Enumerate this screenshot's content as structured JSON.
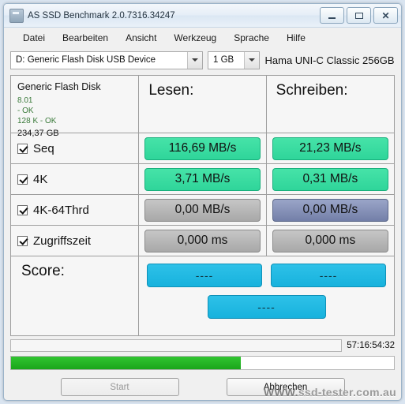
{
  "window": {
    "title": "AS SSD Benchmark 2.0.7316.34247",
    "icon": "app-icon",
    "buttons": {
      "minimize": "minimize-icon",
      "maximize": "maximize-icon",
      "close": "close-icon"
    }
  },
  "menu": [
    "Datei",
    "Bearbeiten",
    "Ansicht",
    "Werkzeug",
    "Sprache",
    "Hilfe"
  ],
  "selector": {
    "device": "D: Generic Flash Disk USB Device",
    "size": "1 GB",
    "product": "Hama UNI-C Classic 256GB"
  },
  "info": {
    "title": "Generic Flash Disk",
    "line1": "8.01",
    "line2": "- OK",
    "line3": "128 K - OK",
    "capacity": "234,37 GB"
  },
  "headers": {
    "read": "Lesen:",
    "write": "Schreiben:"
  },
  "tests": [
    {
      "label": "Seq",
      "checked": true,
      "read": "116,69 MB/s",
      "write": "21,23 MB/s",
      "read_style": "vb-green",
      "write_style": "vb-green"
    },
    {
      "label": "4K",
      "checked": true,
      "read": "3,71 MB/s",
      "write": "0,31 MB/s",
      "read_style": "vb-green",
      "write_style": "vb-green"
    },
    {
      "label": "4K-64Thrd",
      "checked": true,
      "read": "0,00 MB/s",
      "write": "0,00 MB/s",
      "read_style": "vb-gray",
      "write_style": "vb-blueg"
    },
    {
      "label": "Zugriffszeit",
      "checked": true,
      "read": "0,000 ms",
      "write": "0,000 ms",
      "read_style": "vb-gray",
      "write_style": "vb-gray"
    }
  ],
  "score": {
    "label": "Score:",
    "read": "----",
    "write": "----",
    "total": "----"
  },
  "status": {
    "text": "",
    "timer": "57:16:54:32",
    "progress_percent": 60
  },
  "buttons": {
    "start": "Start",
    "cancel": "Abbrechen"
  },
  "watermark": {
    "main": "WWW.",
    "rest": "ssd-tester.com.au"
  },
  "colors": {
    "green": "#2fd59a",
    "cyan": "#17b2dd",
    "gray": "#a8a8a8",
    "blue_gray": "#737fa8",
    "progress": "#1aa51a"
  }
}
